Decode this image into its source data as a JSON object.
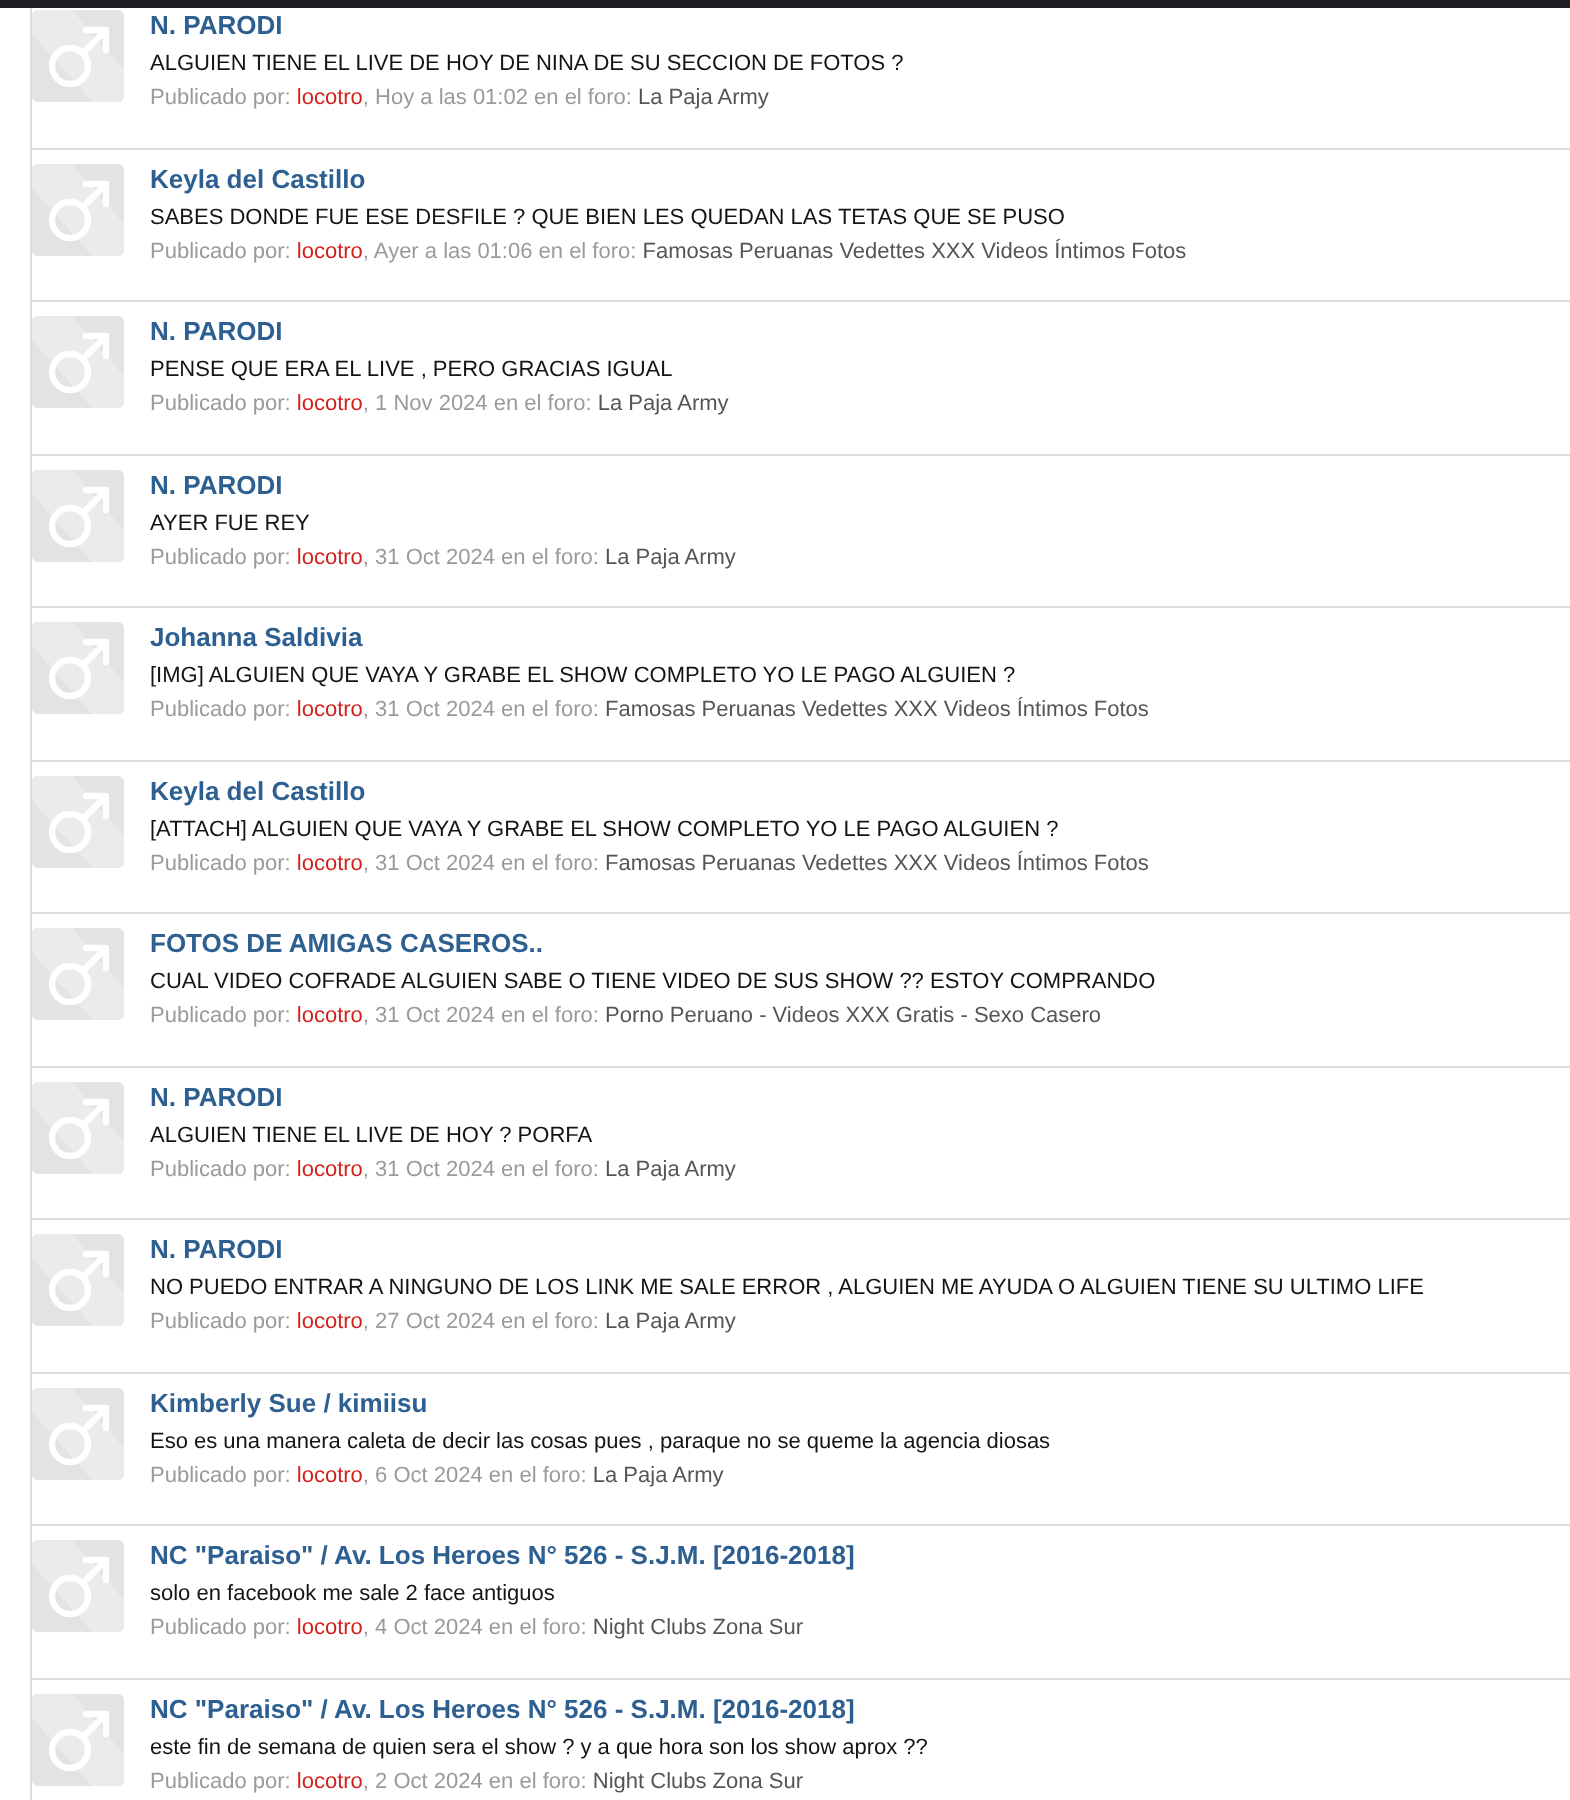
{
  "posts": [
    {
      "title": "N. PARODI",
      "text": "ALGUIEN TIENE EL LIVE DE HOY DE NINA DE SU SECCION DE FOTOS ?",
      "by_label": "Publicado por:",
      "author": "locotro",
      "time": ", Hoy a las 01:02 en el foro:",
      "forum": "La Paja Army"
    },
    {
      "title": "Keyla del Castillo",
      "text": "SABES DONDE FUE ESE DESFILE ? QUE BIEN LES QUEDAN LAS TETAS QUE SE PUSO",
      "by_label": "Publicado por:",
      "author": "locotro",
      "time": ", Ayer a las 01:06 en el foro:",
      "forum": "Famosas Peruanas Vedettes XXX Videos Íntimos Fotos"
    },
    {
      "title": "N. PARODI",
      "text": "PENSE QUE ERA EL LIVE , PERO GRACIAS IGUAL",
      "by_label": "Publicado por:",
      "author": "locotro",
      "time": ", 1 Nov 2024 en el foro:",
      "forum": "La Paja Army"
    },
    {
      "title": "N. PARODI",
      "text": "AYER FUE REY",
      "by_label": "Publicado por:",
      "author": "locotro",
      "time": ", 31 Oct 2024 en el foro:",
      "forum": "La Paja Army"
    },
    {
      "title": "Johanna Saldivia",
      "text": "[IMG] ALGUIEN QUE VAYA Y GRABE EL SHOW COMPLETO YO LE PAGO ALGUIEN ?",
      "by_label": "Publicado por:",
      "author": "locotro",
      "time": ", 31 Oct 2024 en el foro:",
      "forum": "Famosas Peruanas Vedettes XXX Videos Íntimos Fotos"
    },
    {
      "title": "Keyla del Castillo",
      "text": "[ATTACH] ALGUIEN QUE VAYA Y GRABE EL SHOW COMPLETO YO LE PAGO ALGUIEN ?",
      "by_label": "Publicado por:",
      "author": "locotro",
      "time": ", 31 Oct 2024 en el foro:",
      "forum": "Famosas Peruanas Vedettes XXX Videos Íntimos Fotos"
    },
    {
      "title": "FOTOS DE AMIGAS CASEROS..",
      "text": "CUAL VIDEO COFRADE ALGUIEN SABE O TIENE VIDEO DE SUS SHOW ?? ESTOY COMPRANDO",
      "by_label": "Publicado por:",
      "author": "locotro",
      "time": ", 31 Oct 2024 en el foro:",
      "forum": "Porno Peruano - Videos XXX Gratis - Sexo Casero"
    },
    {
      "title": "N. PARODI",
      "text": "ALGUIEN TIENE EL LIVE DE HOY ? PORFA",
      "by_label": "Publicado por:",
      "author": "locotro",
      "time": ", 31 Oct 2024 en el foro:",
      "forum": "La Paja Army"
    },
    {
      "title": "N. PARODI",
      "text": "NO PUEDO ENTRAR A NINGUNO DE LOS LINK ME SALE ERROR , ALGUIEN ME AYUDA O ALGUIEN TIENE SU ULTIMO LIFE",
      "by_label": "Publicado por:",
      "author": "locotro",
      "time": ", 27 Oct 2024 en el foro:",
      "forum": "La Paja Army"
    },
    {
      "title": "Kimberly Sue / kimiisu",
      "text": "Eso es una manera caleta de decir las cosas pues , paraque no se queme la agencia diosas",
      "by_label": "Publicado por:",
      "author": "locotro",
      "time": ", 6 Oct 2024 en el foro:",
      "forum": "La Paja Army"
    },
    {
      "title": "NC \"Paraiso\" / Av. Los Heroes N° 526 - S.J.M. [2016-2018]",
      "text": "solo en facebook me sale 2 face antiguos",
      "by_label": "Publicado por:",
      "author": "locotro",
      "time": ", 4 Oct 2024 en el foro:",
      "forum": "Night Clubs Zona Sur"
    },
    {
      "title": "NC \"Paraiso\" / Av. Los Heroes N° 526 - S.J.M. [2016-2018]",
      "text": "este fin de semana de quien sera el show ? y a que hora son los show aprox ??",
      "by_label": "Publicado por:",
      "author": "locotro",
      "time": ", 2 Oct 2024 en el foro:",
      "forum": "Night Clubs Zona Sur"
    }
  ]
}
